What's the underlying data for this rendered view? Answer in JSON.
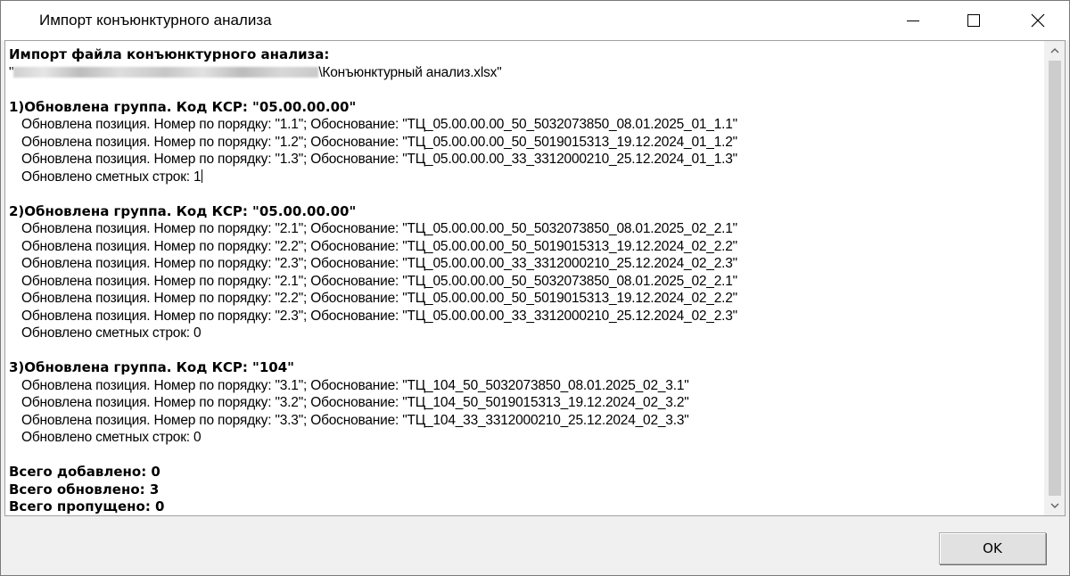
{
  "window": {
    "title": "Импорт конъюнктурного анализа"
  },
  "log": {
    "header": "Импорт файла конъюнктурного анализа:",
    "path_prefix": "\"",
    "path_suffix": "\\Конъюнктурный анализ.xlsx\"",
    "groups": [
      {
        "title": "1)Обновлена группа. Код КСР: \"05.00.00.00\"",
        "positions": [
          "Обновлена позиция. Номер по порядку: \"1.1\"; Обоснование: \"ТЦ_05.00.00.00_50_5032073850_08.01.2025_01_1.1\"",
          "Обновлена позиция. Номер по порядку: \"1.2\"; Обоснование: \"ТЦ_05.00.00.00_50_5019015313_19.12.2024_01_1.2\"",
          "Обновлена позиция. Номер по порядку: \"1.3\"; Обоснование: \"ТЦ_05.00.00.00_33_3312000210_25.12.2024_01_1.3\""
        ],
        "summary": "Обновлено сметных строк: 1"
      },
      {
        "title": "2)Обновлена группа. Код КСР: \"05.00.00.00\"",
        "positions": [
          "Обновлена позиция. Номер по порядку: \"2.1\"; Обоснование: \"ТЦ_05.00.00.00_50_5032073850_08.01.2025_02_2.1\"",
          "Обновлена позиция. Номер по порядку: \"2.2\"; Обоснование: \"ТЦ_05.00.00.00_50_5019015313_19.12.2024_02_2.2\"",
          "Обновлена позиция. Номер по порядку: \"2.3\"; Обоснование: \"ТЦ_05.00.00.00_33_3312000210_25.12.2024_02_2.3\"",
          "Обновлена позиция. Номер по порядку: \"2.1\"; Обоснование: \"ТЦ_05.00.00.00_50_5032073850_08.01.2025_02_2.1\"",
          "Обновлена позиция. Номер по порядку: \"2.2\"; Обоснование: \"ТЦ_05.00.00.00_50_5019015313_19.12.2024_02_2.2\"",
          "Обновлена позиция. Номер по порядку: \"2.3\"; Обоснование: \"ТЦ_05.00.00.00_33_3312000210_25.12.2024_02_2.3\""
        ],
        "summary": "Обновлено сметных строк: 0"
      },
      {
        "title": "3)Обновлена группа. Код КСР: \"104\"",
        "positions": [
          "Обновлена позиция. Номер по порядку: \"3.1\"; Обоснование: \"ТЦ_104_50_5032073850_08.01.2025_02_3.1\"",
          "Обновлена позиция. Номер по порядку: \"3.2\"; Обоснование: \"ТЦ_104_50_5019015313_19.12.2024_02_3.2\"",
          "Обновлена позиция. Номер по порядку: \"3.3\"; Обоснование: \"ТЦ_104_33_3312000210_25.12.2024_02_3.3\""
        ],
        "summary": "Обновлено сметных строк: 0"
      }
    ],
    "totals": [
      "Всего добавлено: 0",
      "Всего обновлено: 3",
      "Всего пропущено: 0"
    ]
  },
  "buttons": {
    "ok_label": "OK"
  },
  "icons": {
    "minimize": "minimize-icon",
    "maximize": "maximize-icon",
    "close": "close-icon",
    "close_glyph": "✕",
    "scroll_up_glyph": "⌃",
    "scroll_down_glyph": "⌄"
  }
}
